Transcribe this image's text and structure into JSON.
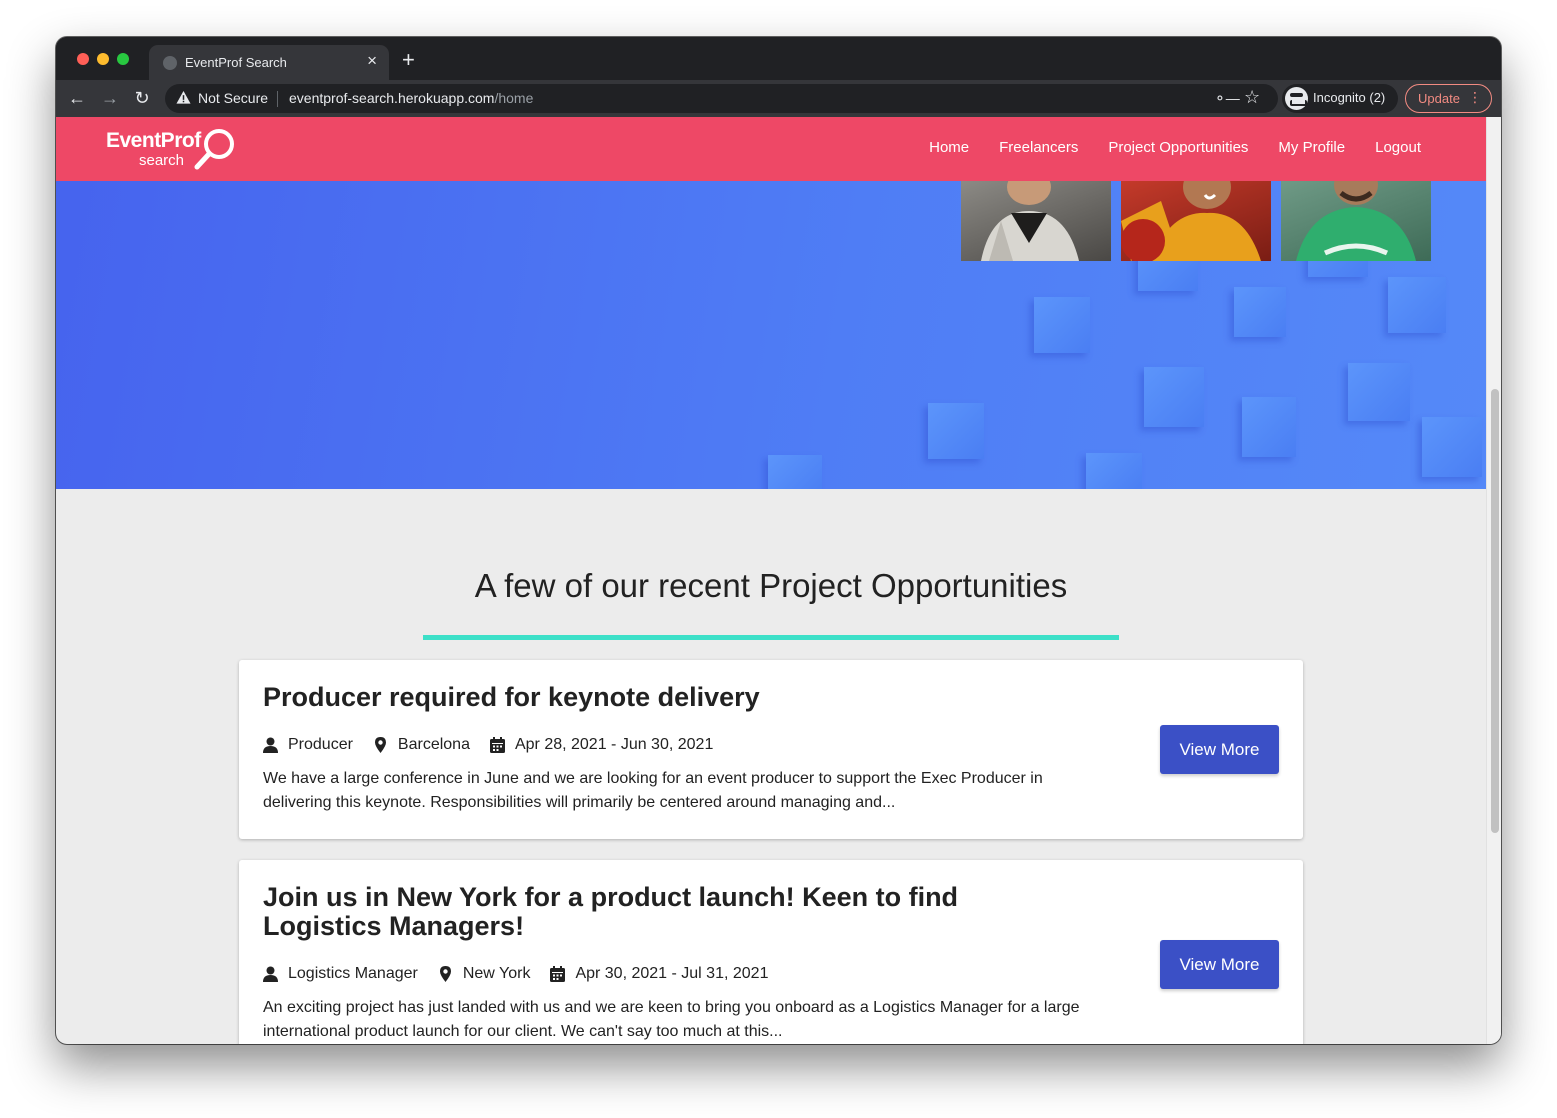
{
  "browser": {
    "tab_title": "EventProf Search",
    "tab_close": "×",
    "new_tab": "+",
    "security_label": "Not Secure",
    "url_host": "eventprof-search.herokuapp.com",
    "url_path": "/home",
    "incognito_label": "Incognito (2)",
    "update_label": "Update"
  },
  "site": {
    "logo_top": "EventProf",
    "logo_bottom": "search",
    "nav": [
      "Home",
      "Freelancers",
      "Project Opportunities",
      "My Profile",
      "Logout"
    ],
    "header_color": "#ee4866",
    "accent_color": "#3de0c8",
    "button_color": "#3b50c6"
  },
  "main": {
    "section_title": "A few of our recent Project Opportunities",
    "opportunities": [
      {
        "title": "Producer required for keynote delivery",
        "role": "Producer",
        "location": "Barcelona",
        "dates": "Apr 28, 2021 - Jun 30, 2021",
        "description": "We have a large conference in June and we are looking for an event producer to support the Exec Producer in delivering this keynote. Responsibilities will primarily be centered around managing and...",
        "button": "View More"
      },
      {
        "title": "Join us in New York for a product launch! Keen to find Logistics Managers!",
        "role": "Logistics Manager",
        "location": "New York",
        "dates": "Apr 30, 2021 - Jul 31, 2021",
        "description": "An exciting project has just landed with us and we are keen to bring you onboard as a Logistics Manager for a large international product launch for our client. We can't say too much at this...",
        "button": "View More"
      }
    ]
  }
}
